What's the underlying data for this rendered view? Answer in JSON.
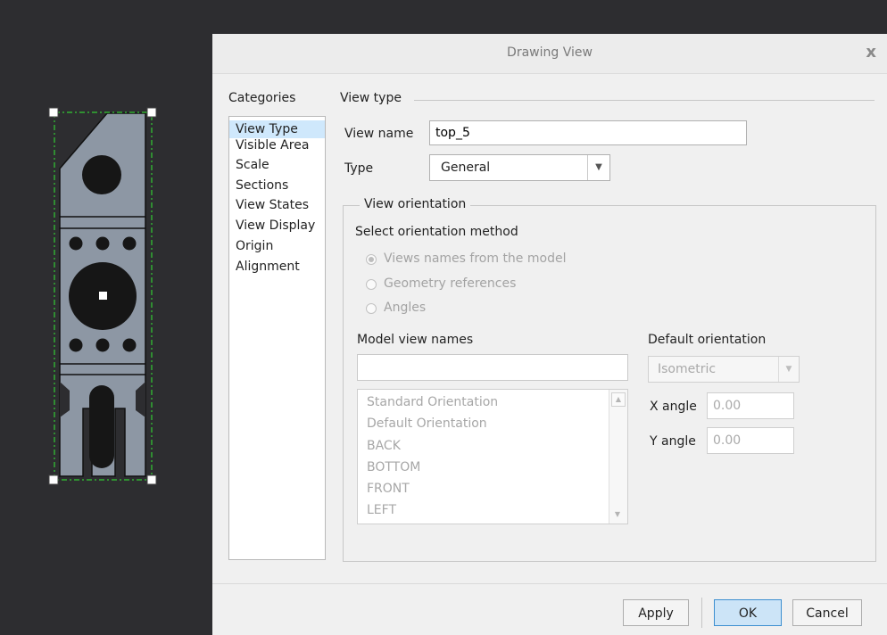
{
  "window": {
    "title": "Drawing View",
    "close_glyph": "x"
  },
  "categories": {
    "title": "Categories",
    "items": [
      "View Type",
      "Visible Area",
      "Scale",
      "Sections",
      "View States",
      "View Display",
      "Origin",
      "Alignment"
    ],
    "selected": "View Type"
  },
  "view_type": {
    "section_title": "View type",
    "view_name_label": "View name",
    "view_name_value": "top_5",
    "type_label": "Type",
    "type_value": "General"
  },
  "orientation": {
    "section_title": "View orientation",
    "method_label": "Select orientation method",
    "methods": [
      "Views names from the model",
      "Geometry references",
      "Angles"
    ],
    "selected_method": "Views names from the model",
    "model_view_names_label": "Model view names",
    "model_view_names_filter": "",
    "model_views": [
      "Standard Orientation",
      "Default Orientation",
      "BACK",
      "BOTTOM",
      "FRONT",
      "LEFT"
    ],
    "default_orientation_label": "Default orientation",
    "default_orientation_value": "Isometric",
    "x_angle_label": "X angle",
    "x_angle_value": "0.00",
    "y_angle_label": "Y angle",
    "y_angle_value": "0.00"
  },
  "buttons": {
    "apply": "Apply",
    "ok": "OK",
    "cancel": "Cancel"
  },
  "colors": {
    "canvas_background": "#2d2d30",
    "part_fill": "#8d97a4",
    "selection_frame": "#33cc33",
    "ok_button_fill": "#cce4f7",
    "selected_category": "#cfe8fc"
  }
}
